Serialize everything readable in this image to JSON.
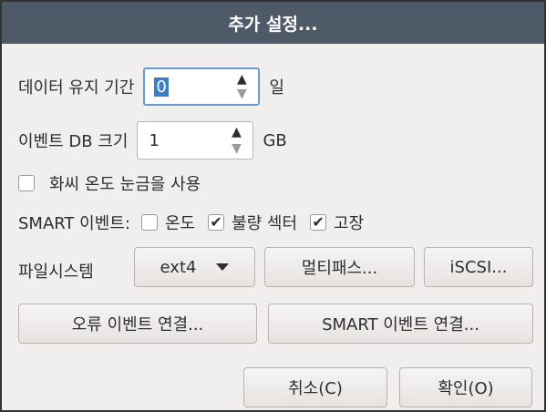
{
  "dialog": {
    "title": "추가 설정..."
  },
  "data_retention": {
    "label": "데이터 유지 기간",
    "value": "0",
    "unit": "일"
  },
  "event_db": {
    "label": "이벤트 DB 크기",
    "value": "1",
    "unit": "GB"
  },
  "fahrenheit": {
    "label": "화씨 온도 눈금을 사용",
    "checked": false
  },
  "smart": {
    "label": "SMART 이벤트:",
    "options": [
      {
        "label": "온도",
        "checked": false
      },
      {
        "label": "불량 섹터",
        "checked": true
      },
      {
        "label": "고장",
        "checked": true
      }
    ]
  },
  "filesystem": {
    "label": "파일시스템",
    "value": "ext4"
  },
  "buttons": {
    "multipath": "멀티패스...",
    "iscsi": "iSCSI...",
    "error_event": "오류 이벤트 연결...",
    "smart_event": "SMART 이벤트 연결...",
    "cancel": "취소(C)",
    "ok": "확인(O)"
  },
  "icons": {
    "check": "✔",
    "up": "▲",
    "down": "▼"
  }
}
